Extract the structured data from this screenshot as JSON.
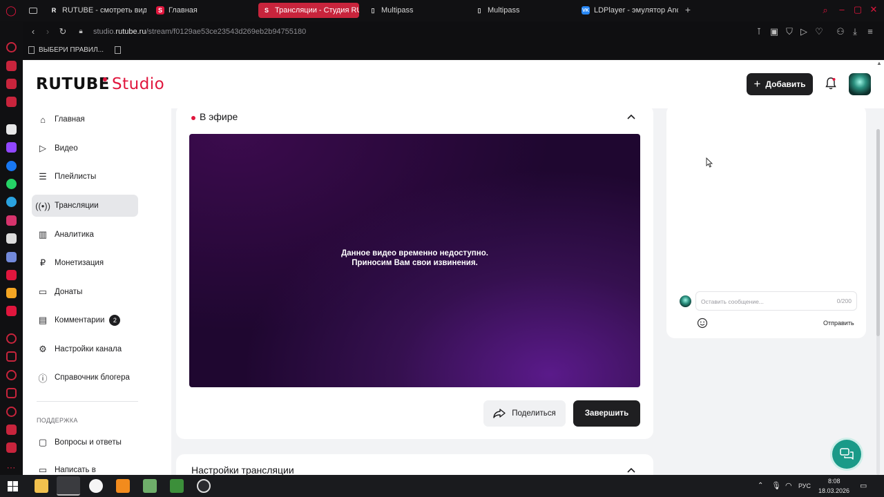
{
  "browser": {
    "tabs": [
      {
        "label": "",
        "icon": "tab-grid-icon",
        "active": false
      },
      {
        "label": "RUTUBE - смотреть виде",
        "icon": "rutube-icon",
        "active": false
      },
      {
        "label": "Главная",
        "icon": "studio-icon",
        "active": false
      },
      {
        "label": "Трансляции - Студия RU",
        "icon": "studio-icon",
        "active": true
      },
      {
        "label": "Multipass",
        "icon": "document-icon",
        "active": false
      },
      {
        "label": "Multipass",
        "icon": "document-icon",
        "active": false
      },
      {
        "label": "LDPlayer - эмулятор Andr",
        "icon": "vk-icon",
        "active": false
      }
    ],
    "url_prefix": "studio.",
    "url_domain": "rutube.ru",
    "url_path": "/stream/f0129ae53ce23543d269eb2b94755180",
    "bookmark": "ВЫБЕРИ ПРАВИЛ...",
    "accent": "#c8243c"
  },
  "header": {
    "logo_main": "RUTUBE",
    "logo_studio": "Studio",
    "add_button": "Добавить",
    "brand_color": "#e0163d"
  },
  "sidebar": {
    "items": [
      {
        "label": "Главная",
        "icon": "home-icon"
      },
      {
        "label": "Видео",
        "icon": "video-icon"
      },
      {
        "label": "Плейлисты",
        "icon": "playlist-icon"
      },
      {
        "label": "Трансляции",
        "icon": "broadcast-icon",
        "active": true
      },
      {
        "label": "Аналитика",
        "icon": "analytics-icon"
      },
      {
        "label": "Монетизация",
        "icon": "ruble-icon"
      },
      {
        "label": "Донаты",
        "icon": "wallet-icon"
      },
      {
        "label": "Комментарии",
        "icon": "comment-icon",
        "badge": "2"
      },
      {
        "label": "Настройки канала",
        "icon": "gear-icon"
      },
      {
        "label": "Справочник блогера",
        "icon": "info-icon"
      }
    ],
    "support_label": "ПОДДЕРЖКА",
    "support_items": [
      {
        "label": "Вопросы и ответы",
        "icon": "question-icon"
      },
      {
        "label": "Написать в",
        "icon": "mail-icon"
      }
    ]
  },
  "stream": {
    "status_title": "В эфире",
    "player_message_line1": "Данное видео временно недоступно.",
    "player_message_line2": "Приносим Вам свои извинения.",
    "share_button": "Поделиться",
    "finish_button": "Завершить",
    "settings_title": "Настройки трансляции"
  },
  "chat": {
    "placeholder": "Оставить сообщение...",
    "counter": "0/200",
    "send_button": "Отправить"
  },
  "taskbar": {
    "lang": "РУС",
    "time": "8:08",
    "date": "18.03.2026"
  }
}
